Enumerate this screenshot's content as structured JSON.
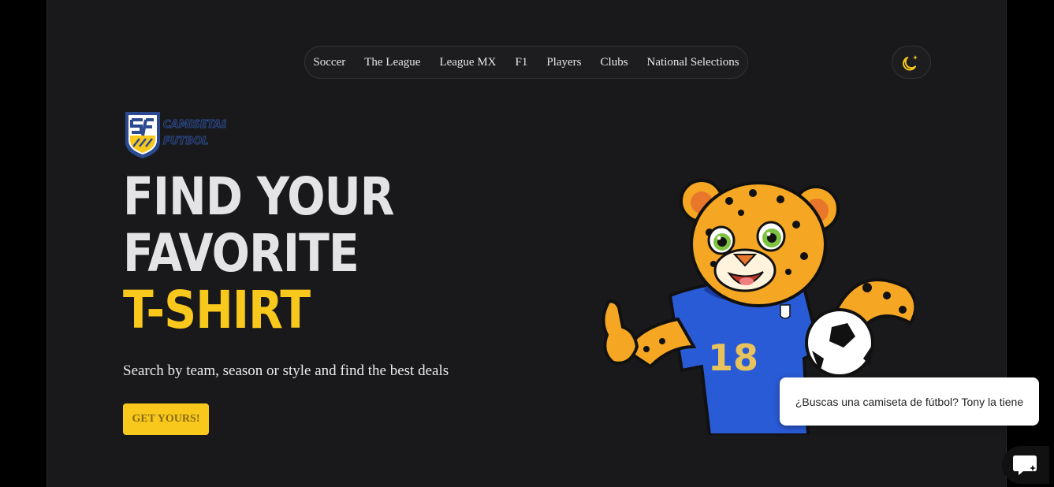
{
  "nav": {
    "items": [
      "Soccer",
      "The League",
      "League MX",
      "F1",
      "Players",
      "Clubs",
      "National Selections"
    ]
  },
  "theme_toggle": {
    "icon": "moon-star-icon"
  },
  "logo": {
    "text_line1": "CAMISETAS",
    "text_line2": "FUTBOL",
    "mark": "SF"
  },
  "hero": {
    "line1": "FIND YOUR",
    "line2": "FAVORITE",
    "line3": "T-SHIRT",
    "subtitle": "Search by team, season or style and find the best deals",
    "cta_label": "GET YOURS!"
  },
  "mascot": {
    "jersey_number": "18"
  },
  "chat": {
    "bubble_text": "¿Buscas una camiseta de fútbol? Tony la tiene",
    "button_icon": "chat-sparkle-icon"
  },
  "colors": {
    "accent": "#f9c81c",
    "background": "#19191b",
    "outer": "#000000",
    "jersey": "#2a5bd7"
  }
}
